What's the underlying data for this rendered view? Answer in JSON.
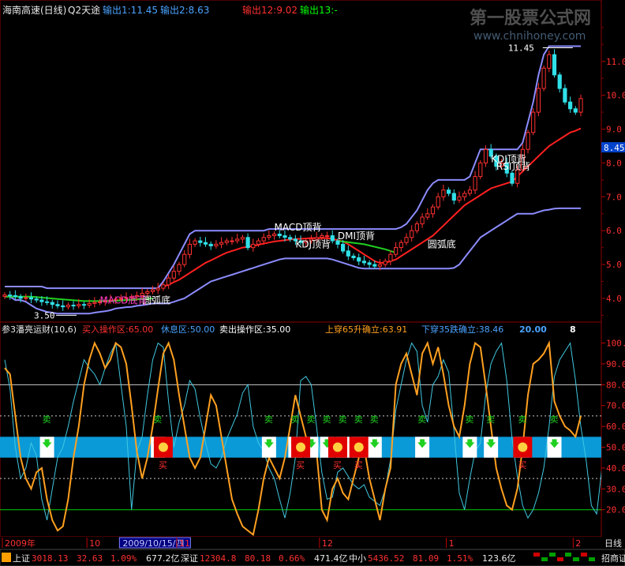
{
  "chart_data": {
    "type": "candlestick",
    "upper": {
      "stock_title": "海南高速(日线)",
      "indicator": "Q2天途",
      "legend": [
        {
          "label": "输出1:11.45",
          "color": "#4aa3ff"
        },
        {
          "label": "输出2:8.63",
          "color": "#4aa3ff"
        },
        {
          "label": "输出12:9.02",
          "color": "#ff3030"
        },
        {
          "label": "输出13:-",
          "color": "#00ff00"
        }
      ],
      "ylim": [
        3.3,
        12.3
      ],
      "y_ticks": [
        4.0,
        5.0,
        6.0,
        7.0,
        8.0,
        9.0,
        10.0,
        11.0
      ],
      "y_tick_labels": [
        "4.0",
        "5.0",
        "6.0",
        "7.0",
        "8.0",
        "9.0",
        "10.0",
        "11.0"
      ],
      "current_price": 8.45,
      "current_price_label": "8.45",
      "high_label": "11.45",
      "high_value": 11.45,
      "high_index": 103,
      "low_label": "3.50",
      "low_value": 3.5,
      "low_index": 10,
      "annotations": [
        {
          "text": "圆弧底",
          "index": 26,
          "value": 3.85,
          "color": "#ffffff"
        },
        {
          "text": "MACD顶背",
          "index": 51,
          "value": 6.0,
          "color": "#ffffff"
        },
        {
          "text": "KDJ顶背",
          "index": 55,
          "value": 5.5,
          "color": "#ffffff"
        },
        {
          "text": "DMI顶背",
          "index": 63,
          "value": 5.75,
          "color": "#ffffff"
        },
        {
          "text": "圆弧底",
          "index": 80,
          "value": 5.5,
          "color": "#ffffff"
        },
        {
          "text": "KDJ顶背",
          "index": 92,
          "value": 8.02,
          "color": "#ffffff"
        },
        {
          "text": "RSI顶背",
          "index": 93,
          "value": 7.8,
          "color": "#ffffff"
        },
        {
          "text": "MACD底背",
          "index": 18,
          "value": 3.85,
          "color": "#ff3cc8"
        }
      ],
      "close": [
        4.1,
        4.08,
        4.05,
        4.0,
        4.02,
        3.98,
        3.95,
        3.9,
        3.88,
        3.82,
        3.78,
        3.75,
        3.8,
        3.78,
        3.82,
        3.8,
        3.85,
        3.88,
        3.9,
        3.92,
        3.95,
        3.98,
        4.0,
        4.02,
        4.05,
        4.08,
        4.15,
        4.2,
        4.25,
        4.3,
        4.4,
        4.6,
        4.8,
        5.0,
        5.3,
        5.6,
        5.7,
        5.65,
        5.6,
        5.55,
        5.6,
        5.65,
        5.7,
        5.7,
        5.75,
        5.8,
        5.5,
        5.6,
        5.7,
        5.8,
        5.85,
        5.9,
        5.85,
        5.8,
        5.75,
        5.7,
        5.65,
        5.7,
        5.75,
        5.8,
        5.85,
        5.85,
        5.7,
        5.6,
        5.4,
        5.25,
        5.2,
        5.1,
        5.05,
        5.0,
        4.95,
        5.0,
        5.1,
        5.3,
        5.5,
        5.65,
        5.8,
        6.0,
        6.2,
        6.4,
        6.5,
        6.7,
        7.0,
        7.2,
        7.1,
        6.9,
        7.0,
        7.1,
        7.2,
        7.6,
        8.0,
        8.4,
        8.2,
        7.9,
        8.0,
        7.7,
        7.4,
        7.8,
        8.4,
        8.9,
        9.5,
        10.2,
        10.8,
        11.2,
        10.6,
        10.2,
        9.8,
        9.6,
        9.5,
        9.9
      ],
      "upper_band": [
        4.35,
        4.35,
        4.35,
        4.35,
        4.35,
        4.35,
        4.35,
        4.35,
        4.3,
        4.3,
        4.3,
        4.3,
        4.3,
        4.3,
        4.3,
        4.3,
        4.3,
        4.3,
        4.3,
        4.3,
        4.3,
        4.3,
        4.3,
        4.3,
        4.3,
        4.3,
        4.3,
        4.3,
        4.3,
        4.3,
        4.5,
        4.75,
        5.0,
        5.3,
        5.6,
        5.9,
        6.0,
        6.0,
        6.0,
        6.0,
        6.0,
        6.0,
        6.0,
        6.0,
        6.0,
        6.0,
        6.0,
        6.0,
        6.0,
        6.0,
        6.05,
        6.05,
        6.05,
        6.05,
        6.05,
        6.05,
        6.05,
        6.05,
        6.05,
        6.05,
        6.05,
        6.05,
        6.05,
        6.05,
        6.05,
        6.05,
        6.05,
        6.05,
        6.05,
        6.05,
        6.05,
        6.05,
        6.05,
        6.05,
        6.05,
        6.1,
        6.2,
        6.4,
        6.6,
        6.9,
        7.2,
        7.4,
        7.5,
        7.5,
        7.5,
        7.5,
        7.5,
        7.5,
        7.6,
        8.0,
        8.4,
        8.4,
        8.4,
        8.4,
        8.4,
        8.4,
        8.4,
        8.4,
        8.6,
        9.2,
        9.8,
        10.6,
        11.2,
        11.45,
        11.45,
        11.45,
        11.45,
        11.45,
        11.45,
        11.45
      ],
      "lower_band": [
        4.05,
        4.05,
        3.95,
        3.95,
        3.9,
        3.8,
        3.7,
        3.65,
        3.6,
        3.58,
        3.55,
        3.55,
        3.55,
        3.55,
        3.55,
        3.55,
        3.55,
        3.58,
        3.6,
        3.62,
        3.65,
        3.7,
        3.72,
        3.74,
        3.75,
        3.78,
        3.8,
        3.82,
        3.85,
        3.85,
        3.85,
        3.85,
        3.9,
        3.95,
        4.0,
        4.1,
        4.2,
        4.3,
        4.4,
        4.5,
        4.55,
        4.6,
        4.65,
        4.7,
        4.75,
        4.8,
        4.85,
        4.9,
        4.95,
        5.0,
        5.05,
        5.1,
        5.15,
        5.18,
        5.18,
        5.18,
        5.18,
        5.18,
        5.18,
        5.18,
        5.18,
        5.18,
        5.15,
        5.1,
        5.05,
        5.0,
        4.95,
        4.9,
        4.88,
        4.88,
        4.88,
        4.88,
        4.88,
        4.88,
        4.88,
        4.88,
        4.88,
        4.88,
        4.88,
        4.88,
        4.88,
        4.88,
        4.88,
        4.88,
        4.88,
        4.9,
        5.0,
        5.2,
        5.4,
        5.6,
        5.8,
        5.9,
        6.0,
        6.1,
        6.2,
        6.3,
        6.4,
        6.5,
        6.5,
        6.5,
        6.5,
        6.55,
        6.6,
        6.62,
        6.65,
        6.66,
        6.66,
        6.66,
        6.66,
        6.66
      ],
      "red_line": [
        null,
        null,
        null,
        null,
        null,
        null,
        null,
        null,
        null,
        null,
        null,
        null,
        null,
        null,
        null,
        null,
        null,
        null,
        null,
        null,
        null,
        null,
        null,
        null,
        null,
        null,
        null,
        null,
        null,
        null,
        4.35,
        4.4,
        4.48,
        4.55,
        4.65,
        4.75,
        4.85,
        4.95,
        5.05,
        5.12,
        5.2,
        5.28,
        5.35,
        5.4,
        5.45,
        5.5,
        5.52,
        5.55,
        5.58,
        5.62,
        5.65,
        5.68,
        5.7,
        5.72,
        5.74,
        5.75,
        5.76,
        5.77,
        5.78,
        5.78,
        5.78,
        5.78,
        5.76,
        5.72,
        5.68,
        5.6,
        5.5,
        5.4,
        5.3,
        5.2,
        5.1,
        5.05,
        5.05,
        5.1,
        5.15,
        5.25,
        5.35,
        5.45,
        5.55,
        5.65,
        5.75,
        5.85,
        6.0,
        6.15,
        6.3,
        6.45,
        6.6,
        6.75,
        6.85,
        6.95,
        7.05,
        7.15,
        7.25,
        7.3,
        7.35,
        7.4,
        7.45,
        7.6,
        7.75,
        7.9,
        8.05,
        8.2,
        8.35,
        8.5,
        8.6,
        8.7,
        8.8,
        8.9,
        8.95,
        9.02
      ],
      "green_segments": [
        [
          0,
          4.05
        ],
        [
          5,
          4.05
        ],
        [
          10,
          3.98
        ],
        [
          15,
          3.92
        ],
        [
          20,
          3.92
        ],
        [
          28,
          4.0
        ],
        [
          63,
          5.7
        ],
        [
          68,
          5.6
        ],
        [
          72,
          5.45
        ],
        [
          74,
          5.35
        ]
      ]
    },
    "lower": {
      "indicator_title": "参3潘亮运财(10,6)",
      "labels": [
        {
          "text": "买入操作区:65.00",
          "color": "#ff3030"
        },
        {
          "text": "休息区:50.00",
          "color": "#4aa3ff"
        },
        {
          "text": "卖出操作区:35.00",
          "color": "#ffffff"
        },
        {
          "text": "上穿65升确立:63.91",
          "color": "#ffa020"
        },
        {
          "text": "下穿35跌确立:38.46",
          "color": "#4aa3ff"
        },
        {
          "text": "20.00",
          "color": "#4aa3ff"
        },
        {
          "text": "8",
          "color": "#ffffff"
        }
      ],
      "ylim": [
        7,
        104
      ],
      "y_ticks": [
        20,
        30,
        40,
        50,
        60,
        70,
        80,
        90,
        100
      ],
      "y_tick_labels": [
        "20.0",
        "30.0",
        "40.0",
        "50.0",
        "60.0",
        "70.0",
        "80.0",
        "90.0",
        "100.0"
      ],
      "hlines": [
        {
          "value": 80,
          "color": "#c8c8c8"
        },
        {
          "value": 20,
          "color": "#00d000"
        },
        {
          "value": 35,
          "color": "#c8c8c8",
          "dashed": true
        },
        {
          "value": 65,
          "color": "#c8c8c8",
          "dashed": true
        }
      ],
      "band": {
        "from": 45,
        "to": 55,
        "color": "#0a9ad8"
      },
      "orange": [
        88,
        85,
        65,
        45,
        35,
        30,
        38,
        40,
        25,
        15,
        10,
        12,
        25,
        45,
        60,
        80,
        92,
        100,
        95,
        88,
        92,
        100,
        98,
        90,
        70,
        48,
        35,
        45,
        60,
        78,
        95,
        100,
        92,
        75,
        60,
        45,
        40,
        45,
        60,
        75,
        70,
        55,
        40,
        25,
        18,
        12,
        10,
        8,
        20,
        35,
        45,
        40,
        35,
        45,
        60,
        75,
        65,
        55,
        50,
        48,
        20,
        15,
        30,
        35,
        28,
        25,
        35,
        45,
        50,
        35,
        25,
        15,
        30,
        40,
        80,
        90,
        95,
        85,
        75,
        95,
        100,
        90,
        98,
        85,
        70,
        60,
        55,
        70,
        90,
        100,
        98,
        80,
        60,
        40,
        30,
        22,
        20,
        30,
        50,
        75,
        90,
        92,
        95,
        100,
        72,
        65,
        60,
        58,
        55,
        65
      ],
      "blue": [
        92,
        78,
        50,
        35,
        40,
        52,
        46,
        25,
        15,
        30,
        45,
        50,
        60,
        72,
        82,
        92,
        88,
        85,
        80,
        88,
        95,
        100,
        80,
        60,
        20,
        48,
        55,
        75,
        92,
        100,
        98,
        72,
        50,
        62,
        70,
        82,
        78,
        64,
        52,
        42,
        40,
        45,
        54,
        60,
        66,
        76,
        80,
        60,
        52,
        48,
        40,
        35,
        25,
        16,
        28,
        45,
        82,
        84,
        80,
        60,
        38,
        25,
        26,
        38,
        40,
        36,
        32,
        30,
        32,
        26,
        24,
        22,
        30,
        44,
        68,
        80,
        92,
        100,
        96,
        70,
        62,
        80,
        84,
        92,
        86,
        58,
        28,
        20,
        35,
        48,
        52,
        75,
        90,
        96,
        100,
        82,
        54,
        36,
        22,
        16,
        20,
        28,
        40,
        60,
        84,
        92,
        96,
        100,
        82,
        60,
        44,
        22,
        18,
        40
      ],
      "buy_signals": [
        8,
        29,
        50,
        55,
        58,
        61,
        64,
        67,
        70,
        79,
        88,
        92,
        98,
        104
      ],
      "sell_signals": [
        30,
        56,
        63,
        67,
        98
      ]
    },
    "x_axis": {
      "labels": [
        {
          "text": "2009年",
          "index": 0
        },
        {
          "text": "10",
          "index": 16
        },
        {
          "text": "2009/10/15/四",
          "index": 22,
          "highlight": true
        },
        {
          "text": "11",
          "index": 33
        },
        {
          "text": "12",
          "index": 60
        },
        {
          "text": "1",
          "index": 84
        },
        {
          "text": "2",
          "index": 108
        }
      ],
      "right_label": "日线"
    }
  },
  "header": {
    "title": "海南高速(日线)",
    "indicator": "Q2天途"
  },
  "y_axis": {
    "current_price": "8.45"
  },
  "lower": {
    "title": "参3潘亮运财(10,6)"
  },
  "ticker": {
    "items": [
      {
        "name": "上证",
        "price": "3018.13",
        "change": "32.63",
        "pct": "1.09%",
        "vol": "677.2亿"
      },
      {
        "name": "深证",
        "price": "12304.8",
        "change": "80.18",
        "pct": "0.66%",
        "vol": "471.4亿"
      },
      {
        "name": "中小",
        "price": "5436.52",
        "change": "81.09",
        "pct": "1.51%",
        "vol": "123.6亿"
      }
    ],
    "broker": "招商证"
  },
  "watermark": {
    "title": "第一股票公式网",
    "url": "www.chnihoney.com"
  }
}
